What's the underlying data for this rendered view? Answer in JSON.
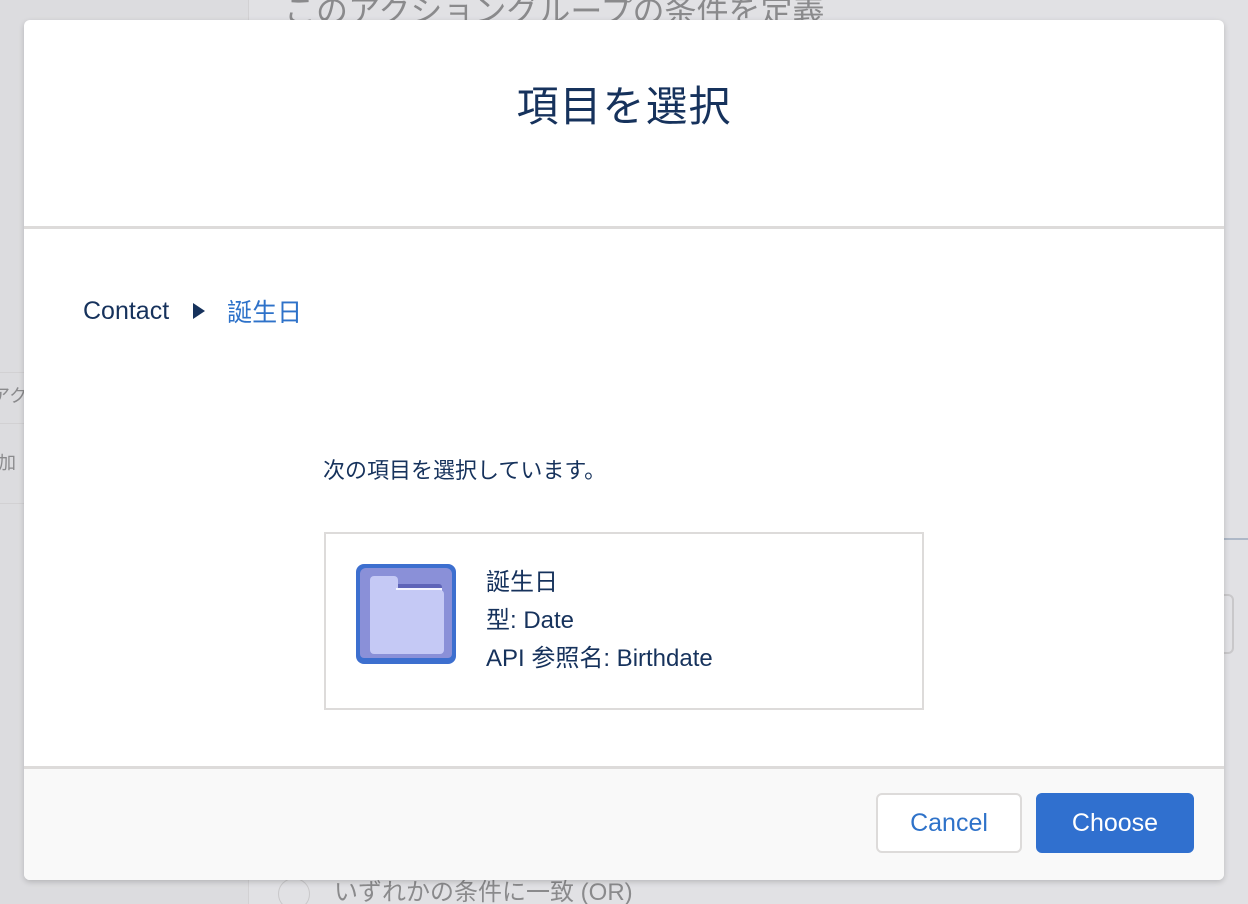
{
  "background": {
    "heading": "このアクショングループの条件を定義",
    "left_row1_text": "アクシ",
    "left_row2_text": "加",
    "radio_option_or": "いずれかの条件に一致 (OR)"
  },
  "modal": {
    "title": "項目を選択",
    "breadcrumb": {
      "root": "Contact",
      "separator_icon": "triangle-right-icon",
      "current": "誕生日"
    },
    "selected_label": "次の項目を選択しています。",
    "field_card": {
      "icon": "folder-icon",
      "name": "誕生日",
      "type_line": "型: Date",
      "api_line": "API 参照名: Birthdate"
    },
    "footer": {
      "cancel_label": "Cancel",
      "choose_label": "Choose"
    }
  },
  "colors": {
    "brand": "#3070cf",
    "link": "#2e72c9",
    "text": "#16325c",
    "border": "#dddbda",
    "footer_bg": "#f9f9f9"
  }
}
